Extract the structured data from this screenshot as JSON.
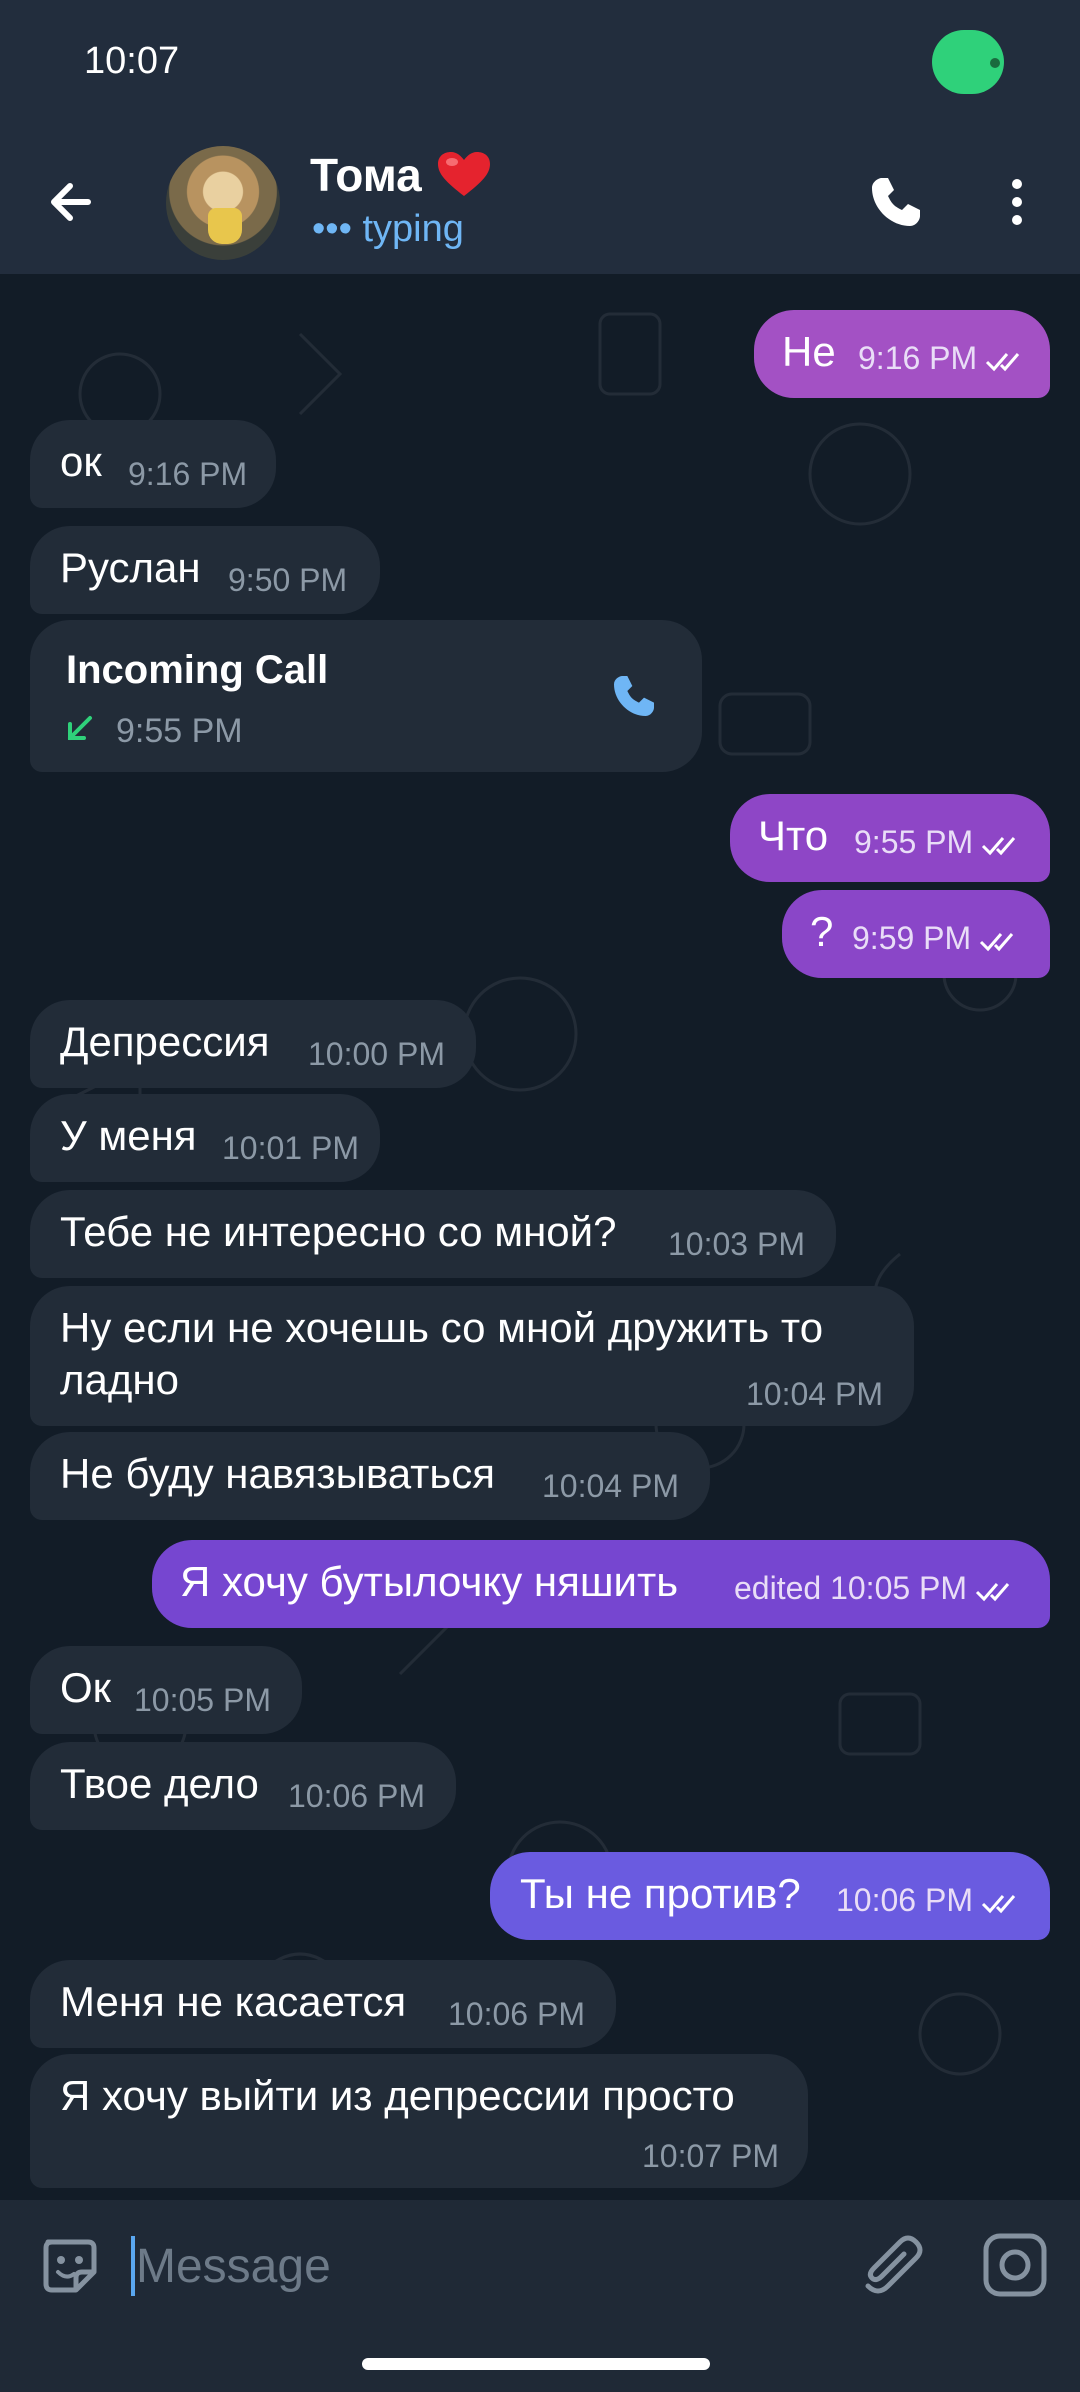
{
  "status_bar": {
    "time": "10:07"
  },
  "header": {
    "contact_name": "Тома",
    "status": "typing",
    "icons": [
      "arrow-left-icon",
      "heart-icon",
      "phone-icon",
      "more-vertical-icon"
    ]
  },
  "colors": {
    "background": "#121c27",
    "incoming_bubble": "#222c38",
    "accent_blue": "#6fb6f5",
    "call_green": "#2fd17a"
  },
  "messages": [
    {
      "dir": "out",
      "text": "Не",
      "time": "9:16 PM",
      "color": "#a351c4"
    },
    {
      "dir": "in",
      "text": "ок",
      "time": "9:16 PM"
    },
    {
      "dir": "in",
      "text": "Руслан",
      "time": "9:50 PM"
    },
    {
      "dir": "in",
      "type": "call",
      "title": "Incoming Call",
      "time": "9:55 PM"
    },
    {
      "dir": "out",
      "text": "Что",
      "time": "9:55 PM",
      "color": "#8e46c6"
    },
    {
      "dir": "out",
      "text": "?",
      "time": "9:59 PM",
      "color": "#8a46c8"
    },
    {
      "dir": "in",
      "text": "Депрессия",
      "time": "10:00 PM"
    },
    {
      "dir": "in",
      "text": "У меня",
      "time": "10:01 PM"
    },
    {
      "dir": "in",
      "text": "Тебе не интересно со мной?",
      "time": "10:03 PM"
    },
    {
      "dir": "in",
      "text_line1": "Ну если не хочешь со мной дружить то",
      "text_line2": "ладно",
      "time": "10:04 PM"
    },
    {
      "dir": "in",
      "text": "Не буду навязываться",
      "time": "10:04 PM"
    },
    {
      "dir": "out",
      "text": "Я хочу бутылочку няшить",
      "time": "edited 10:05 PM",
      "color": "#7646d0"
    },
    {
      "dir": "in",
      "text": "Ок",
      "time": "10:05 PM"
    },
    {
      "dir": "in",
      "text": "Твое дело",
      "time": "10:06 PM"
    },
    {
      "dir": "out",
      "text": "Ты не против?",
      "time": "10:06 PM",
      "color": "#6a5be0"
    },
    {
      "dir": "in",
      "text": "Меня не касается",
      "time": "10:06 PM"
    },
    {
      "dir": "in",
      "text": "Я хочу выйти из депрессии просто",
      "time": "10:07 PM"
    }
  ],
  "input": {
    "placeholder": "Message"
  }
}
